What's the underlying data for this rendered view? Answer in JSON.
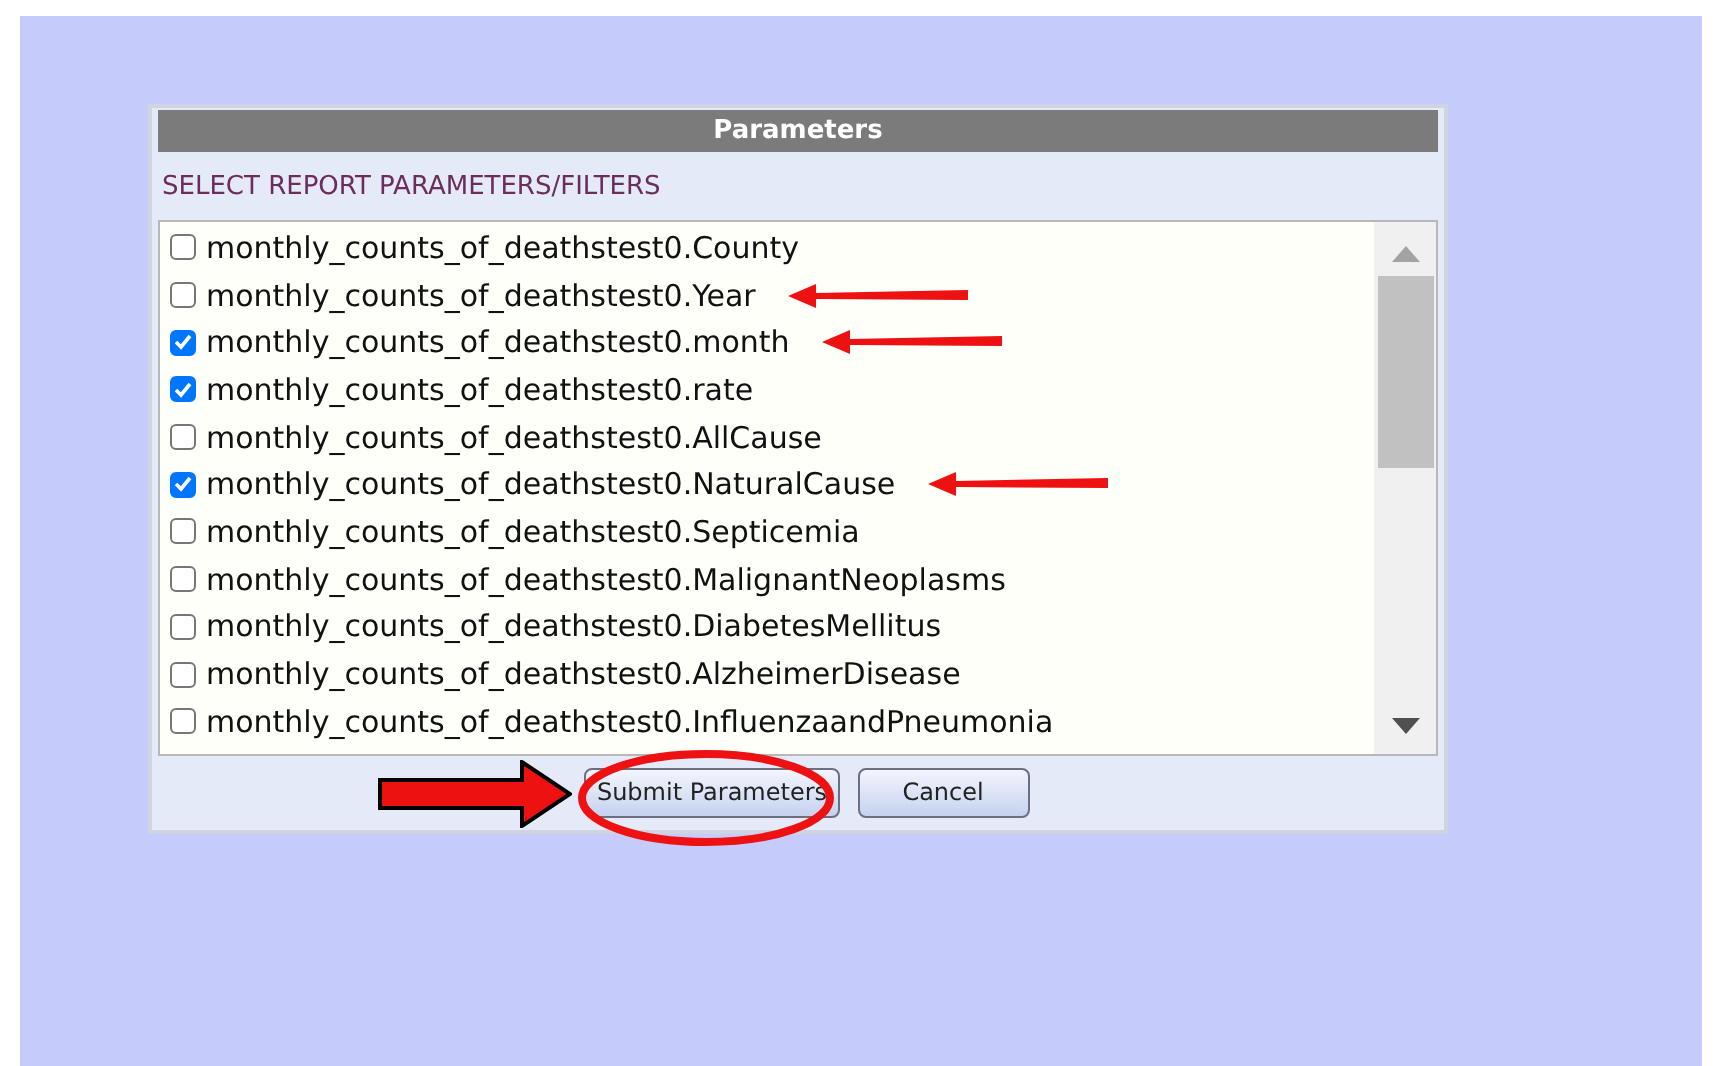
{
  "dialog": {
    "title": "Parameters",
    "subtitle": "SELECT REPORT PARAMETERS/FILTERS",
    "items": [
      {
        "label": "monthly_counts_of_deathstest0.County",
        "checked": false,
        "annotated": false
      },
      {
        "label": "monthly_counts_of_deathstest0.Year",
        "checked": false,
        "annotated": true
      },
      {
        "label": "monthly_counts_of_deathstest0.month",
        "checked": true,
        "annotated": true
      },
      {
        "label": "monthly_counts_of_deathstest0.rate",
        "checked": true,
        "annotated": false
      },
      {
        "label": "monthly_counts_of_deathstest0.AllCause",
        "checked": false,
        "annotated": false
      },
      {
        "label": "monthly_counts_of_deathstest0.NaturalCause",
        "checked": true,
        "annotated": true
      },
      {
        "label": "monthly_counts_of_deathstest0.Septicemia",
        "checked": false,
        "annotated": false
      },
      {
        "label": "monthly_counts_of_deathstest0.MalignantNeoplasms",
        "checked": false,
        "annotated": false
      },
      {
        "label": "monthly_counts_of_deathstest0.DiabetesMellitus",
        "checked": false,
        "annotated": false
      },
      {
        "label": "monthly_counts_of_deathstest0.AlzheimerDisease",
        "checked": false,
        "annotated": false
      },
      {
        "label": "monthly_counts_of_deathstest0.InfluenzaandPneumonia",
        "checked": false,
        "annotated": false
      }
    ],
    "buttons": [
      {
        "label": "Submit Parameters",
        "annotated": true
      },
      {
        "label": "Cancel",
        "annotated": false
      }
    ]
  }
}
